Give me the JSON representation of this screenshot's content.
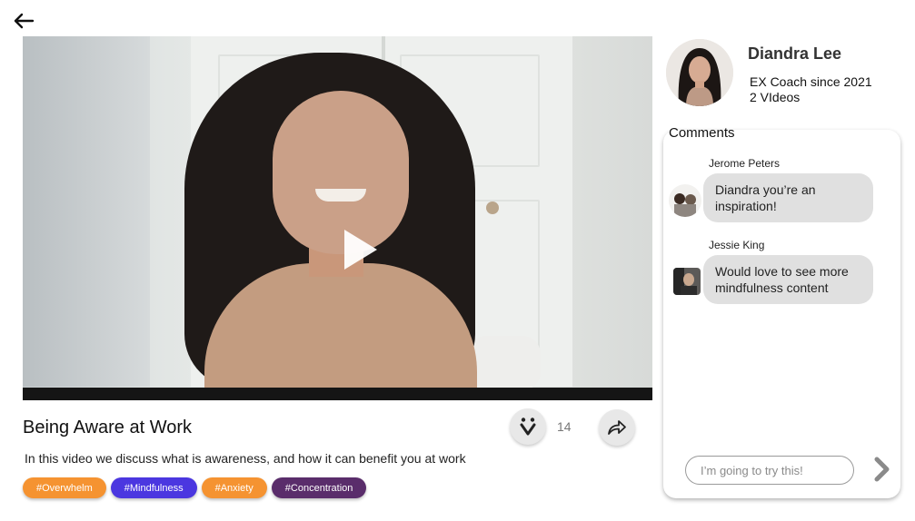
{
  "video": {
    "title": "Being Aware at Work",
    "description": "In this video we discuss what is awareness, and how it can benefit you at work",
    "reaction_count": "14",
    "tags": [
      {
        "label": "#Overwhelm",
        "color": "#f59331"
      },
      {
        "label": "#Mindfulness",
        "color": "#4b37e0"
      },
      {
        "label": "#Anxiety",
        "color": "#f59331"
      },
      {
        "label": "#Concentration",
        "color": "#5a2d6b"
      }
    ]
  },
  "coach": {
    "name": "Diandra Lee",
    "since": "EX Coach since 2021",
    "videos": "2 VIdeos"
  },
  "comments": {
    "title": "Comments",
    "items": [
      {
        "author": "Jerome Peters",
        "text": "Diandra you’re an inspiration!"
      },
      {
        "author": "Jessie King",
        "text": "Would love to see more mindfulness content"
      }
    ],
    "input_placeholder": "I’m going to try this!"
  },
  "icons": {
    "back": "arrow-left-icon",
    "play": "play-icon",
    "reaction": "reaction-face-icon",
    "share": "share-icon",
    "send": "chevron-right-icon"
  }
}
